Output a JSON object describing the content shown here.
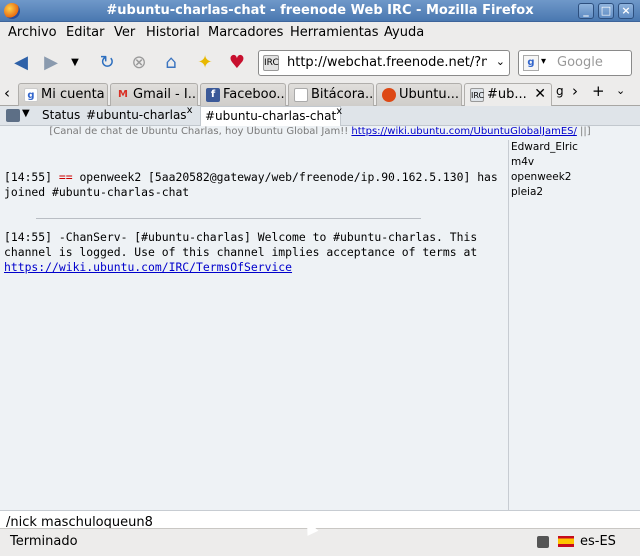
{
  "window": {
    "title": "#ubuntu-charlas-chat - freenode Web IRC - Mozilla Firefox"
  },
  "menu": [
    "Archivo",
    "Editar",
    "Ver",
    "Historial",
    "Marcadores",
    "Herramientas",
    "Ayuda"
  ],
  "nav": {
    "url": "http://webchat.freenode.net/?nicks=",
    "search_placeholder": "Google"
  },
  "tabs": [
    {
      "label": "Mi cuenta",
      "icon": "google-icon"
    },
    {
      "label": "Gmail - I...",
      "icon": "gmail-icon"
    },
    {
      "label": "Faceboo...",
      "icon": "facebook-icon"
    },
    {
      "label": "Bitácora...",
      "icon": "page-icon"
    },
    {
      "label": "Ubuntu...",
      "icon": "ubuntu-icon"
    },
    {
      "label": "#ub...",
      "icon": "irc-icon"
    }
  ],
  "irc": {
    "tabs": [
      "Status",
      "#ubuntu-charlas",
      "#ubuntu-charlas-chat"
    ],
    "topic_text": "[Canal de chat de Ubuntu Charlas, hoy Ubuntu Global Jam!! ",
    "topic_link": "https://wiki.ubuntu.com/UbuntuGlobalJamES/",
    "topic_end": " ||]",
    "messages": [
      {
        "ts": "[14:55] ",
        "marker": "==",
        "text": " openweek2 [5aa20582@gateway/web/freenode/ip.90.162.5.130] has joined #ubuntu-charlas-chat"
      },
      {
        "ts": "[14:55] ",
        "text": "-ChanServ- [#ubuntu-charlas] Welcome to #ubuntu-charlas. This channel is logged. Use of this channel implies acceptance of terms at ",
        "link": "https://wiki.ubuntu.com/IRC/TermsOfService"
      }
    ],
    "nicks": [
      "Edward_Elric",
      "m4v",
      "openweek2",
      "pleia2"
    ],
    "input_value": "/nick maschuloqueun8"
  },
  "status": {
    "text": "Terminado",
    "locale": "es-ES"
  }
}
